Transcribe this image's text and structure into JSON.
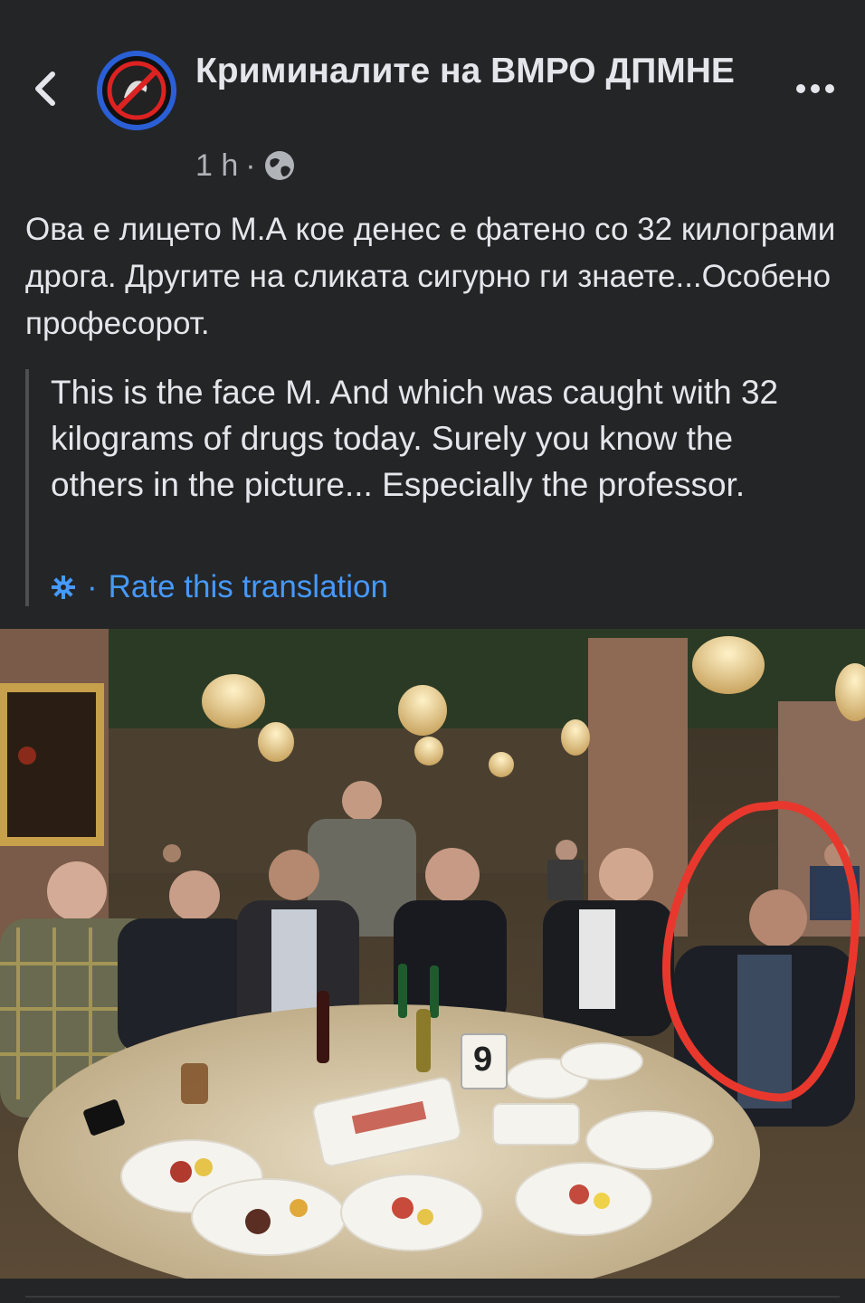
{
  "header": {
    "page_name": "Криминалите на ВМРО ДПМНЕ",
    "time": "1 h",
    "separator": "·",
    "privacy_icon": "globe-icon",
    "back_icon": "chevron-left-icon",
    "more_icon": "more-horizontal-icon",
    "avatar_icon": "page-avatar-logo"
  },
  "post": {
    "text": "Ова е лицето М.А кое денес е фатено со 32 килограми дрога. Другите на сликата сигурно ги знаете...Особено професорот.",
    "translation": "This is the face M. And which was caught with 32 kilograms of drugs today. Surely you know the others in the picture... Especially the professor.",
    "rate_separator": "·",
    "rate_label": "Rate this translation",
    "rate_icon": "gear-icon"
  },
  "photo": {
    "table_number": "9"
  },
  "colors": {
    "background": "#242526",
    "text": "#e4e6eb",
    "secondary": "#b0b3b8",
    "link": "#4599ff",
    "circle_annotation": "#e8382d"
  }
}
